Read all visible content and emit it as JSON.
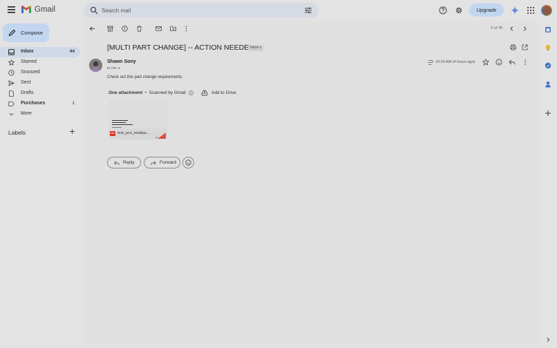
{
  "app": {
    "name": "Gmail"
  },
  "search": {
    "placeholder": "Search mail"
  },
  "header": {
    "upgrade_label": "Upgrade"
  },
  "compose": {
    "label": "Compose"
  },
  "nav": {
    "items": [
      {
        "label": "Inbox",
        "count": "44",
        "icon": "inbox-icon"
      },
      {
        "label": "Starred",
        "count": "",
        "icon": "star-icon"
      },
      {
        "label": "Snoozed",
        "count": "",
        "icon": "clock-icon"
      },
      {
        "label": "Sent",
        "count": "",
        "icon": "send-icon"
      },
      {
        "label": "Drafts",
        "count": "",
        "icon": "draft-icon"
      },
      {
        "label": "Purchases",
        "count": "1",
        "icon": "label-icon"
      },
      {
        "label": "More",
        "count": "",
        "icon": "chevron-down-icon"
      }
    ],
    "labels_heading": "Labels"
  },
  "toolbar": {
    "pager": "2 of 78"
  },
  "email": {
    "subject": "[MULTI PART CHANGE] -- ACTION NEEDED",
    "tag": "Inbox",
    "tag_close": "x",
    "sender": "Shawn Sony",
    "to": "to me",
    "timestamp": "10:24 AM (4 hours ago)",
    "body": "Check out this part change requirements.",
    "attachment_heading": "One attachment",
    "scanned": "Scanned by Gmail",
    "add_to_drive": "Add to Drive",
    "attachment_badge": "PDF",
    "attachment_name": "test_pcn_multipa..."
  },
  "actions": {
    "reply": "Reply",
    "forward": "Forward"
  },
  "colors": {
    "accent": "#c2d6f0",
    "active_nav": "#cfd9e8",
    "pdf_red": "#d93025"
  }
}
